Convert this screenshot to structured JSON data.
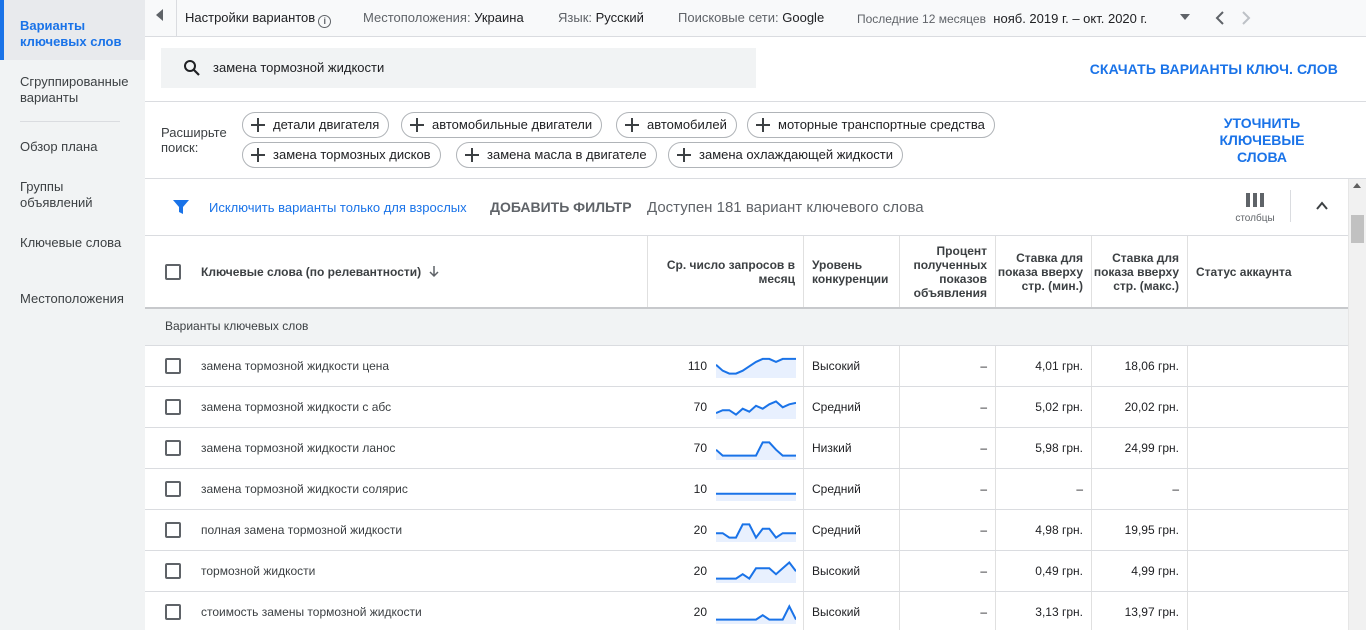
{
  "sidebar": {
    "items": [
      {
        "label": "Варианты ключевых слов",
        "active": true
      },
      {
        "label": "Сгруппированные варианты",
        "active": false
      },
      {
        "label": "Обзор плана",
        "active": false
      },
      {
        "label": "Группы объявлений",
        "active": false
      },
      {
        "label": "Ключевые слова",
        "active": false
      },
      {
        "label": "Местоположения",
        "active": false
      }
    ]
  },
  "topbar": {
    "settings": "Настройки вариантов",
    "location_label": "Местоположения:",
    "location_value": "Украина",
    "language_label": "Язык:",
    "language_value": "Русский",
    "network_label": "Поисковые сети:",
    "network_value": "Google",
    "period_label": "Последние 12 месяцев",
    "period_value": "нояб. 2019 г. – окт. 2020 г."
  },
  "search": {
    "value": "замена тормозной жидкости",
    "download_label": "СКАЧАТЬ ВАРИАНТЫ КЛЮЧ. СЛОВ"
  },
  "broaden": {
    "label": "Расширьте поиск:",
    "chips": [
      "детали двигателя",
      "автомобильные двигатели",
      "автомобилей",
      "моторные транспортные средства",
      "замена тормозных дисков",
      "замена масла в двигателе",
      "замена охлаждающей жидкости"
    ],
    "refine_label": "УТОЧНИТЬ КЛЮЧЕВЫЕ СЛОВА"
  },
  "filter": {
    "exclude_adult": "Исключить варианты только для взрослых",
    "add_filter": "ДОБАВИТЬ ФИЛЬТР",
    "available": "Доступен 181 вариант ключевого слова",
    "columns_label": "столбцы"
  },
  "table": {
    "headers": {
      "keyword": "Ключевые слова (по релевантности)",
      "avg_searches": "Ср. число запросов в месяц",
      "competition": "Уровень конкуренции",
      "impr_share": "Процент полученных показов объявления",
      "bid_low": "Ставка для показа вверху стр. (мин.)",
      "bid_high": "Ставка для показа вверху стр. (макс.)",
      "status": "Статус аккаунта"
    },
    "group_label": "Варианты ключевых слов",
    "rows": [
      {
        "keyword": "замена тормозной жидкости цена",
        "searches": "110",
        "competition": "Высокий",
        "share": "–",
        "low": "4,01 грн.",
        "high": "18,06 грн.",
        "trend": [
          9,
          5,
          3,
          3,
          5,
          8,
          11,
          13,
          13,
          11,
          13,
          13,
          13
        ]
      },
      {
        "keyword": "замена тормозной жидкости с абс",
        "searches": "70",
        "competition": "Средний",
        "share": "–",
        "low": "5,02 грн.",
        "high": "20,02 грн.",
        "trend": [
          4,
          6,
          6,
          3,
          7,
          5,
          9,
          7,
          10,
          12,
          8,
          10,
          11
        ]
      },
      {
        "keyword": "замена тормозной жидкости ланос",
        "searches": "70",
        "competition": "Низкий",
        "share": "–",
        "low": "5,98 грн.",
        "high": "24,99 грн.",
        "trend": [
          7,
          3,
          3,
          3,
          3,
          3,
          3,
          12,
          12,
          7,
          3,
          3,
          3
        ]
      },
      {
        "keyword": "замена тормозной жидкости солярис",
        "searches": "10",
        "competition": "Средний",
        "share": "–",
        "low": "–",
        "high": "–",
        "trend": [
          5,
          5,
          5,
          5,
          5,
          5,
          5,
          5,
          5,
          5,
          5,
          5,
          5
        ]
      },
      {
        "keyword": "полная замена тормозной жидкости",
        "searches": "20",
        "competition": "Средний",
        "share": "–",
        "low": "4,98 грн.",
        "high": "19,95 грн.",
        "trend": [
          6,
          6,
          3,
          3,
          12,
          12,
          3,
          9,
          9,
          3,
          6,
          6,
          6
        ]
      },
      {
        "keyword": "тормозной жидкости",
        "searches": "20",
        "competition": "Высокий",
        "share": "–",
        "low": "0,49 грн.",
        "high": "4,99 грн.",
        "trend": [
          3,
          3,
          3,
          3,
          6,
          3,
          10,
          10,
          10,
          6,
          10,
          14,
          8
        ]
      },
      {
        "keyword": "стоимость замены тормозной жидкости",
        "searches": "20",
        "competition": "Высокий",
        "share": "–",
        "low": "3,13 грн.",
        "high": "13,97 грн.",
        "trend": [
          3,
          3,
          3,
          3,
          3,
          3,
          3,
          6,
          3,
          3,
          3,
          12,
          3
        ]
      }
    ]
  }
}
